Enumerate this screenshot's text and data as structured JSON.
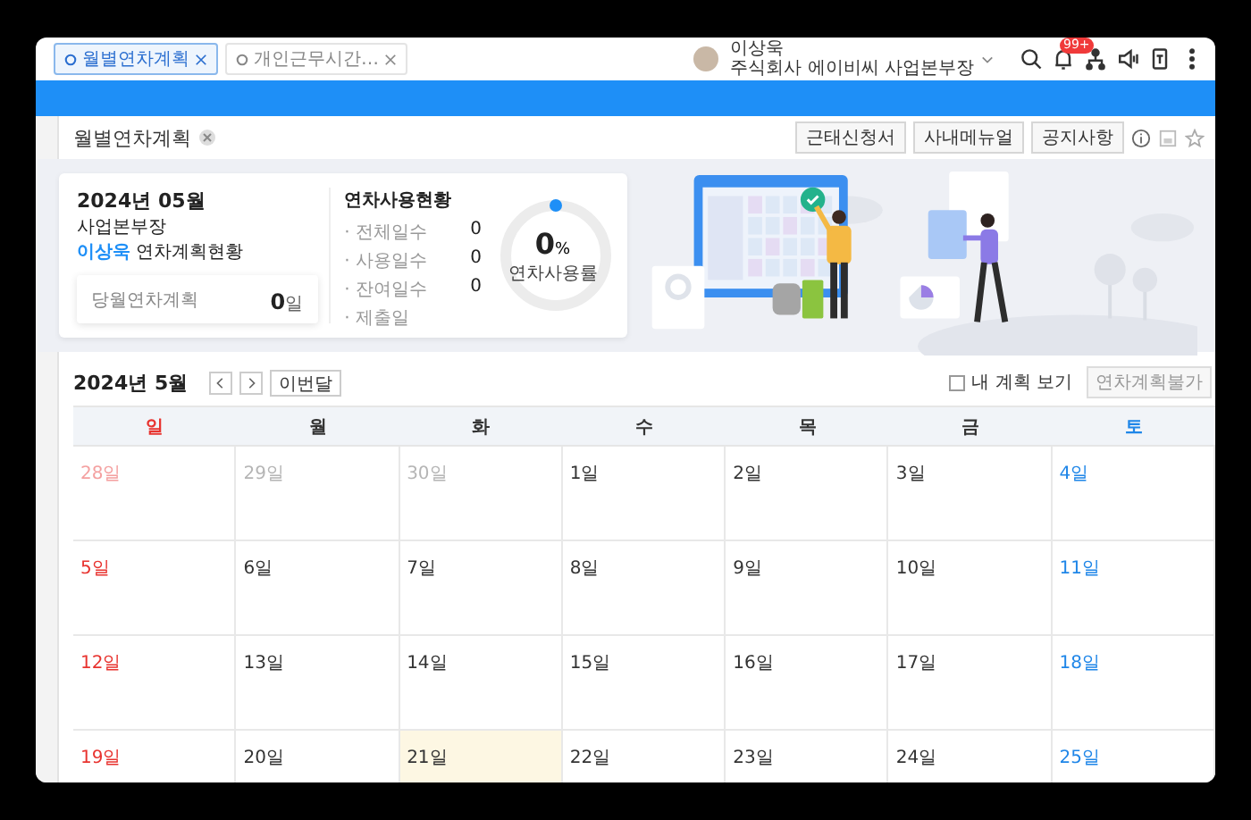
{
  "tabs": [
    {
      "label": "월별연차계획",
      "selected": true
    },
    {
      "label": "개인근무시간…",
      "selected": false
    }
  ],
  "user": {
    "name": "이상욱",
    "position": "주식회사 에이비씨 사업본부장",
    "notification_badge": "99+"
  },
  "page_title": "월별연차계획",
  "header_buttons": [
    "근태신청서",
    "사내메뉴얼",
    "공지사항"
  ],
  "summary": {
    "period": "2024년 05월",
    "role": "사업본부장",
    "name": "이상욱",
    "heading_suffix": "연차계획현황",
    "monthly_plan": {
      "label": "당월연차계획",
      "value": "0",
      "unit": "일"
    },
    "usage_title": "연차사용현황",
    "usage_rows": [
      {
        "label": "· 전체일수",
        "value": "0"
      },
      {
        "label": "· 사용일수",
        "value": "0"
      },
      {
        "label": "· 잔여일수",
        "value": "0"
      },
      {
        "label": "· 제출일"
      }
    ],
    "rate": {
      "value": "0",
      "unit": "%",
      "label": "연차사용률"
    }
  },
  "calendar": {
    "title": "2024년 5월",
    "today_button": "이번달",
    "my_plan": {
      "label": "내 계획 보기",
      "checked": false
    },
    "action_button": "연차계획불가",
    "weekdays": [
      {
        "label": "일",
        "kind": "sun"
      },
      {
        "label": "월",
        "kind": "weekday"
      },
      {
        "label": "화",
        "kind": "weekday"
      },
      {
        "label": "수",
        "kind": "weekday"
      },
      {
        "label": "목",
        "kind": "weekday"
      },
      {
        "label": "금",
        "kind": "weekday"
      },
      {
        "label": "토",
        "kind": "sat"
      }
    ],
    "weeks": [
      [
        {
          "label": "28일",
          "kind": "sun",
          "other_month": true,
          "today": false
        },
        {
          "label": "29일",
          "kind": "weekday",
          "other_month": true,
          "today": false
        },
        {
          "label": "30일",
          "kind": "weekday",
          "other_month": true,
          "today": false
        },
        {
          "label": "1일",
          "kind": "weekday",
          "other_month": false,
          "today": false
        },
        {
          "label": "2일",
          "kind": "weekday",
          "other_month": false,
          "today": false
        },
        {
          "label": "3일",
          "kind": "weekday",
          "other_month": false,
          "today": false
        },
        {
          "label": "4일",
          "kind": "sat",
          "other_month": false,
          "today": false
        }
      ],
      [
        {
          "label": "5일",
          "kind": "sun",
          "other_month": false,
          "today": false
        },
        {
          "label": "6일",
          "kind": "weekday",
          "other_month": false,
          "today": false
        },
        {
          "label": "7일",
          "kind": "weekday",
          "other_month": false,
          "today": false
        },
        {
          "label": "8일",
          "kind": "weekday",
          "other_month": false,
          "today": false
        },
        {
          "label": "9일",
          "kind": "weekday",
          "other_month": false,
          "today": false
        },
        {
          "label": "10일",
          "kind": "weekday",
          "other_month": false,
          "today": false
        },
        {
          "label": "11일",
          "kind": "sat",
          "other_month": false,
          "today": false
        }
      ],
      [
        {
          "label": "12일",
          "kind": "sun",
          "other_month": false,
          "today": false
        },
        {
          "label": "13일",
          "kind": "weekday",
          "other_month": false,
          "today": false
        },
        {
          "label": "14일",
          "kind": "weekday",
          "other_month": false,
          "today": false
        },
        {
          "label": "15일",
          "kind": "weekday",
          "other_month": false,
          "today": false
        },
        {
          "label": "16일",
          "kind": "weekday",
          "other_month": false,
          "today": false
        },
        {
          "label": "17일",
          "kind": "weekday",
          "other_month": false,
          "today": false
        },
        {
          "label": "18일",
          "kind": "sat",
          "other_month": false,
          "today": false
        }
      ],
      [
        {
          "label": "19일",
          "kind": "sun",
          "other_month": false,
          "today": false
        },
        {
          "label": "20일",
          "kind": "weekday",
          "other_month": false,
          "today": false
        },
        {
          "label": "21일",
          "kind": "weekday",
          "other_month": false,
          "today": true
        },
        {
          "label": "22일",
          "kind": "weekday",
          "other_month": false,
          "today": false
        },
        {
          "label": "23일",
          "kind": "weekday",
          "other_month": false,
          "today": false
        },
        {
          "label": "24일",
          "kind": "weekday",
          "other_month": false,
          "today": false
        },
        {
          "label": "25일",
          "kind": "sat",
          "other_month": false,
          "today": false
        }
      ]
    ]
  }
}
